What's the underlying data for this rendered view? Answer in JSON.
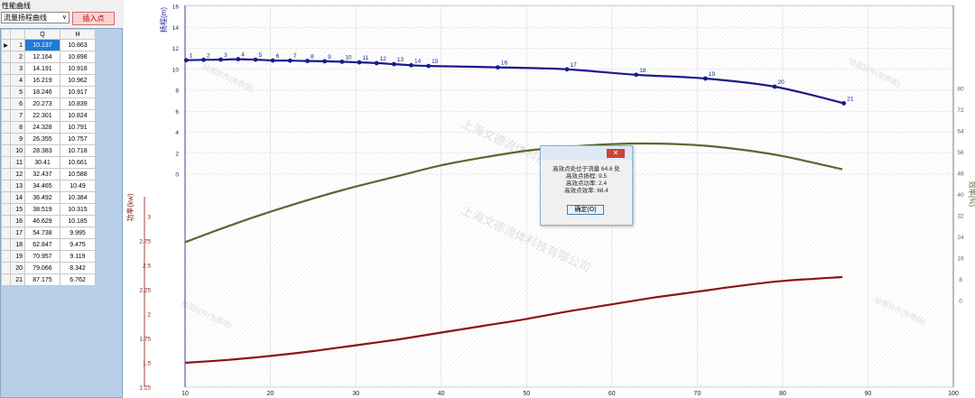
{
  "sidebar": {
    "group_label": "性能曲线",
    "curve_select_value": "流量扬程曲线",
    "insert_button": "插入点",
    "columns": [
      "Q",
      "H"
    ],
    "rows": [
      {
        "n": "1",
        "q": "10.137",
        "h": "10.863"
      },
      {
        "n": "2",
        "q": "12.164",
        "h": "10.898"
      },
      {
        "n": "3",
        "q": "14.191",
        "h": "10.918"
      },
      {
        "n": "4",
        "q": "16.219",
        "h": "10.962"
      },
      {
        "n": "5",
        "q": "18.246",
        "h": "10.917"
      },
      {
        "n": "6",
        "q": "20.273",
        "h": "10.839"
      },
      {
        "n": "7",
        "q": "22.301",
        "h": "10.824"
      },
      {
        "n": "8",
        "q": "24.328",
        "h": "10.791"
      },
      {
        "n": "9",
        "q": "26.355",
        "h": "10.757"
      },
      {
        "n": "10",
        "q": "28.383",
        "h": "10.718"
      },
      {
        "n": "11",
        "q": "30.41",
        "h": "10.661"
      },
      {
        "n": "12",
        "q": "32.437",
        "h": "10.588"
      },
      {
        "n": "13",
        "q": "34.465",
        "h": "10.49"
      },
      {
        "n": "14",
        "q": "36.492",
        "h": "10.384"
      },
      {
        "n": "15",
        "q": "38.519",
        "h": "10.315"
      },
      {
        "n": "16",
        "q": "46.629",
        "h": "10.185"
      },
      {
        "n": "17",
        "q": "54.738",
        "h": "9.995"
      },
      {
        "n": "18",
        "q": "62.847",
        "h": "9.475"
      },
      {
        "n": "19",
        "q": "70.957",
        "h": "9.119"
      },
      {
        "n": "20",
        "q": "79.066",
        "h": "8.342"
      },
      {
        "n": "21",
        "q": "87.175",
        "h": "6.762"
      }
    ]
  },
  "colors": {
    "head": "#1a1a8c",
    "power": "#8b1414",
    "efficiency": "#556b2f",
    "efficiency_axis": "#5a6b3a"
  },
  "chart_data": {
    "type": "line",
    "x_ticks": [
      "10",
      "20",
      "30",
      "40",
      "50",
      "60",
      "70",
      "80",
      "90",
      "100"
    ],
    "xlim": [
      10,
      100
    ],
    "head_axis": {
      "label": "扬程(m)",
      "ticks": [
        "0",
        "2",
        "4",
        "6",
        "8",
        "10",
        "12",
        "14",
        "16"
      ],
      "ylim": [
        0,
        16
      ]
    },
    "power_axis": {
      "label": "功率(kw)",
      "ticks": [
        "1.25",
        "1.5",
        "1.75",
        "2",
        "2.25",
        "2.5",
        "2.75",
        "3"
      ],
      "ylim": [
        1.25,
        3
      ]
    },
    "efficiency_axis": {
      "label": "效率(%)",
      "ticks": [
        "0",
        "8",
        "16",
        "24",
        "32",
        "40",
        "48",
        "56",
        "64",
        "72",
        "80"
      ],
      "ylim": [
        0,
        80
      ]
    },
    "series": [
      {
        "key": "head",
        "x": [
          10.137,
          12.164,
          14.191,
          16.219,
          18.246,
          20.273,
          22.301,
          24.328,
          26.355,
          28.383,
          30.41,
          32.437,
          34.465,
          36.492,
          38.519,
          46.629,
          54.738,
          62.847,
          70.957,
          79.066,
          87.175
        ],
        "y": [
          10.863,
          10.898,
          10.918,
          10.962,
          10.917,
          10.839,
          10.824,
          10.791,
          10.757,
          10.718,
          10.661,
          10.588,
          10.49,
          10.384,
          10.315,
          10.185,
          9.995,
          9.475,
          9.119,
          8.342,
          6.762
        ],
        "point_labels": [
          "1",
          "2",
          "3",
          "4",
          "5",
          "6",
          "7",
          "8",
          "9",
          "10",
          "11",
          "12",
          "13",
          "14",
          "15",
          "16",
          "17",
          "18",
          "19",
          "20",
          "21"
        ]
      },
      {
        "key": "efficiency",
        "x": [
          10,
          15,
          20,
          25,
          30,
          35,
          40,
          45,
          50,
          55,
          60,
          65,
          70,
          75,
          80,
          87
        ],
        "y": [
          22,
          28,
          33.5,
          38.5,
          43,
          47,
          51,
          54,
          56.5,
          58,
          59,
          59.2,
          58.6,
          57,
          54.5,
          49.5
        ]
      },
      {
        "key": "power",
        "x": [
          10,
          15,
          20,
          25,
          30,
          35,
          40,
          45,
          50,
          55,
          60,
          65,
          70,
          75,
          80,
          87
        ],
        "y": [
          1.5,
          1.53,
          1.57,
          1.62,
          1.68,
          1.74,
          1.81,
          1.88,
          1.95,
          2.03,
          2.1,
          2.17,
          2.23,
          2.29,
          2.34,
          2.38
        ]
      }
    ]
  },
  "dialog": {
    "lines": [
      "高效点处位于流量 64.6 处",
      "高效点扬程: 9.5",
      "高效点功率: 2.4",
      "高效点效率: 68.4"
    ],
    "ok_button": "确定(O)",
    "close_glyph": "✕"
  },
  "watermark": "上海文德流体科技有限公司",
  "watermark_small": "给图软件(免费版)"
}
